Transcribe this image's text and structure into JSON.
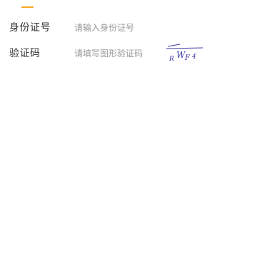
{
  "form": {
    "id_card": {
      "label": "身份证号",
      "placeholder": "请输入身份证号"
    },
    "captcha": {
      "label": "验证码",
      "placeholder": "请填写图形验证码",
      "image_text": [
        "R",
        "W",
        "F",
        "4"
      ]
    }
  },
  "colors": {
    "accent": "#f5a623",
    "label": "#333333",
    "placeholder": "#999999",
    "captcha_ink": "#3a3aa0"
  }
}
